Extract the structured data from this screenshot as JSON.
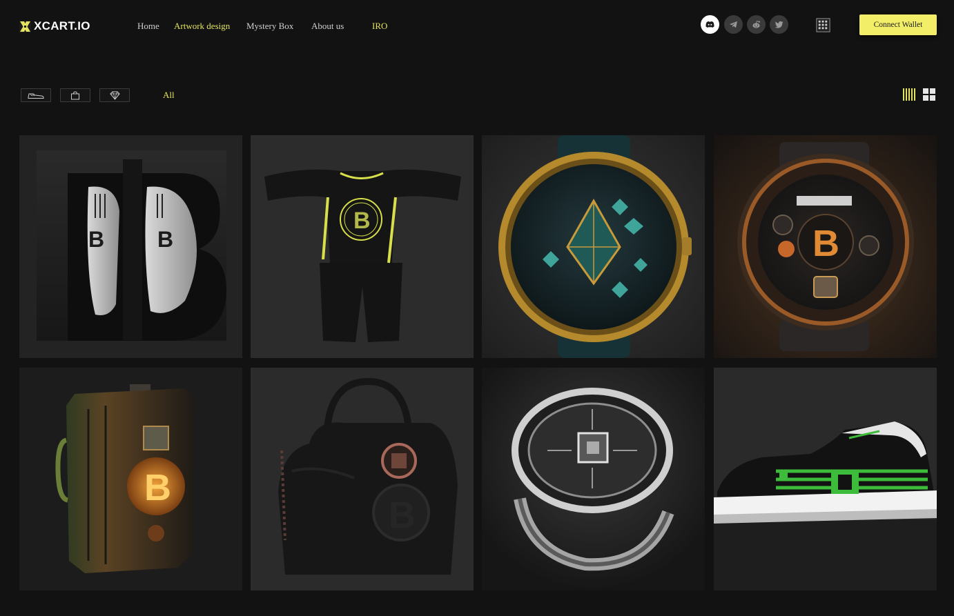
{
  "brand": {
    "name": "XCART.IO",
    "accent_color": "#e3e35f",
    "button_color": "#f2ee68",
    "background_color": "#121212"
  },
  "nav": {
    "items": [
      {
        "label": "Home",
        "active": false
      },
      {
        "label": "Artwork design",
        "active": true
      },
      {
        "label": "Mystery Box",
        "active": false
      },
      {
        "label": "About us",
        "active": false
      },
      {
        "label": "IRO",
        "active": false
      }
    ]
  },
  "socials": [
    {
      "icon": "discord-icon",
      "active": true
    },
    {
      "icon": "telegram-icon",
      "active": false
    },
    {
      "icon": "reddit-icon",
      "active": false
    },
    {
      "icon": "twitter-icon",
      "active": false
    }
  ],
  "language_icon": "language-icon",
  "header": {
    "connect_wallet_label": "Connect Wallet"
  },
  "filters": {
    "categories": [
      {
        "icon": "sneaker-icon"
      },
      {
        "icon": "bag-icon"
      },
      {
        "icon": "diamond-icon"
      }
    ],
    "all_label": "All"
  },
  "view_toggles": [
    {
      "icon": "column-view-icon",
      "active": true
    },
    {
      "icon": "grid-view-icon",
      "active": false
    }
  ],
  "gallery": {
    "items": [
      {
        "subject": "bitcoin-sneakers-artwork"
      },
      {
        "subject": "bitcoin-outfit-artwork"
      },
      {
        "subject": "ethereum-watch-artwork"
      },
      {
        "subject": "bitcoin-watch-artwork"
      },
      {
        "subject": "bitcoin-suitcase-artwork"
      },
      {
        "subject": "bitcoin-handbag-artwork"
      },
      {
        "subject": "crypto-ring-artwork"
      },
      {
        "subject": "green-sneaker-artwork"
      }
    ]
  }
}
